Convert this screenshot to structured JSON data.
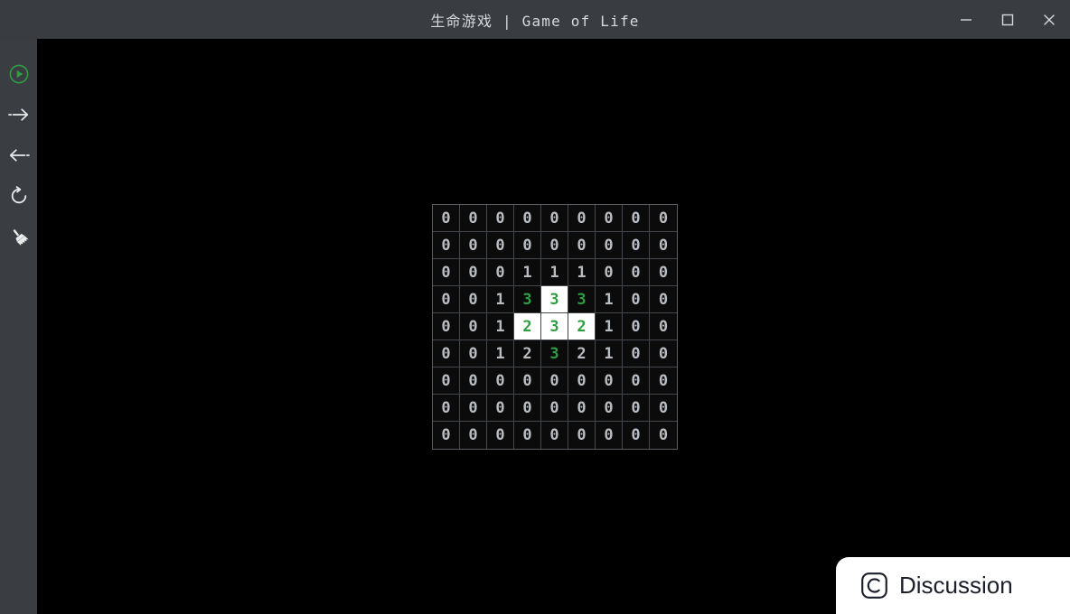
{
  "window": {
    "title": "生命游戏 | Game of Life",
    "controls": {
      "minimize": "minimize-button",
      "maximize": "maximize-button",
      "close": "close-button"
    }
  },
  "sidebar": {
    "items": [
      {
        "name": "play-button",
        "icon": "play-circle-icon",
        "color": "#2f9e41",
        "tooltip": "Play"
      },
      {
        "name": "step-forward-button",
        "icon": "arrow-right-icon",
        "color": "#e8eaec",
        "tooltip": "Step Forward"
      },
      {
        "name": "step-back-button",
        "icon": "arrow-left-icon",
        "color": "#e8eaec",
        "tooltip": "Step Back"
      },
      {
        "name": "reset-button",
        "icon": "refresh-icon",
        "color": "#e8eaec",
        "tooltip": "Reset"
      },
      {
        "name": "clear-button",
        "icon": "broom-icon",
        "color": "#e8eaec",
        "tooltip": "Clear"
      }
    ]
  },
  "discussion": {
    "label": "Discussion",
    "icon": "c-rounded-square-icon"
  },
  "colors": {
    "titlebar_bg": "#393c41",
    "sidebar_bg": "#3a3d42",
    "canvas_bg": "#000000",
    "cell_bg": "#0b0b0b",
    "cell_border": "#44474c",
    "grid_border": "#5a5d62",
    "text_dim": "#b9bcc0",
    "accent_green": "#2f9e41",
    "alive_bg": "#ffffff"
  },
  "grid": {
    "rows": 9,
    "cols": 9,
    "cell_size": 30,
    "cells": [
      [
        {
          "v": "0",
          "alive": false,
          "green": false
        },
        {
          "v": "0",
          "alive": false,
          "green": false
        },
        {
          "v": "0",
          "alive": false,
          "green": false
        },
        {
          "v": "0",
          "alive": false,
          "green": false
        },
        {
          "v": "0",
          "alive": false,
          "green": false
        },
        {
          "v": "0",
          "alive": false,
          "green": false
        },
        {
          "v": "0",
          "alive": false,
          "green": false
        },
        {
          "v": "0",
          "alive": false,
          "green": false
        },
        {
          "v": "0",
          "alive": false,
          "green": false
        }
      ],
      [
        {
          "v": "0",
          "alive": false,
          "green": false
        },
        {
          "v": "0",
          "alive": false,
          "green": false
        },
        {
          "v": "0",
          "alive": false,
          "green": false
        },
        {
          "v": "0",
          "alive": false,
          "green": false
        },
        {
          "v": "0",
          "alive": false,
          "green": false
        },
        {
          "v": "0",
          "alive": false,
          "green": false
        },
        {
          "v": "0",
          "alive": false,
          "green": false
        },
        {
          "v": "0",
          "alive": false,
          "green": false
        },
        {
          "v": "0",
          "alive": false,
          "green": false
        }
      ],
      [
        {
          "v": "0",
          "alive": false,
          "green": false
        },
        {
          "v": "0",
          "alive": false,
          "green": false
        },
        {
          "v": "0",
          "alive": false,
          "green": false
        },
        {
          "v": "1",
          "alive": false,
          "green": false
        },
        {
          "v": "1",
          "alive": false,
          "green": false
        },
        {
          "v": "1",
          "alive": false,
          "green": false
        },
        {
          "v": "0",
          "alive": false,
          "green": false
        },
        {
          "v": "0",
          "alive": false,
          "green": false
        },
        {
          "v": "0",
          "alive": false,
          "green": false
        }
      ],
      [
        {
          "v": "0",
          "alive": false,
          "green": false
        },
        {
          "v": "0",
          "alive": false,
          "green": false
        },
        {
          "v": "1",
          "alive": false,
          "green": false
        },
        {
          "v": "3",
          "alive": false,
          "green": true
        },
        {
          "v": "3",
          "alive": true,
          "green": true
        },
        {
          "v": "3",
          "alive": false,
          "green": true
        },
        {
          "v": "1",
          "alive": false,
          "green": false
        },
        {
          "v": "0",
          "alive": false,
          "green": false
        },
        {
          "v": "0",
          "alive": false,
          "green": false
        }
      ],
      [
        {
          "v": "0",
          "alive": false,
          "green": false
        },
        {
          "v": "0",
          "alive": false,
          "green": false
        },
        {
          "v": "1",
          "alive": false,
          "green": false
        },
        {
          "v": "2",
          "alive": true,
          "green": true
        },
        {
          "v": "3",
          "alive": true,
          "green": true
        },
        {
          "v": "2",
          "alive": true,
          "green": true
        },
        {
          "v": "1",
          "alive": false,
          "green": false
        },
        {
          "v": "0",
          "alive": false,
          "green": false
        },
        {
          "v": "0",
          "alive": false,
          "green": false
        }
      ],
      [
        {
          "v": "0",
          "alive": false,
          "green": false
        },
        {
          "v": "0",
          "alive": false,
          "green": false
        },
        {
          "v": "1",
          "alive": false,
          "green": false
        },
        {
          "v": "2",
          "alive": false,
          "green": false
        },
        {
          "v": "3",
          "alive": false,
          "green": true
        },
        {
          "v": "2",
          "alive": false,
          "green": false
        },
        {
          "v": "1",
          "alive": false,
          "green": false
        },
        {
          "v": "0",
          "alive": false,
          "green": false
        },
        {
          "v": "0",
          "alive": false,
          "green": false
        }
      ],
      [
        {
          "v": "0",
          "alive": false,
          "green": false
        },
        {
          "v": "0",
          "alive": false,
          "green": false
        },
        {
          "v": "0",
          "alive": false,
          "green": false
        },
        {
          "v": "0",
          "alive": false,
          "green": false
        },
        {
          "v": "0",
          "alive": false,
          "green": false
        },
        {
          "v": "0",
          "alive": false,
          "green": false
        },
        {
          "v": "0",
          "alive": false,
          "green": false
        },
        {
          "v": "0",
          "alive": false,
          "green": false
        },
        {
          "v": "0",
          "alive": false,
          "green": false
        }
      ],
      [
        {
          "v": "0",
          "alive": false,
          "green": false
        },
        {
          "v": "0",
          "alive": false,
          "green": false
        },
        {
          "v": "0",
          "alive": false,
          "green": false
        },
        {
          "v": "0",
          "alive": false,
          "green": false
        },
        {
          "v": "0",
          "alive": false,
          "green": false
        },
        {
          "v": "0",
          "alive": false,
          "green": false
        },
        {
          "v": "0",
          "alive": false,
          "green": false
        },
        {
          "v": "0",
          "alive": false,
          "green": false
        },
        {
          "v": "0",
          "alive": false,
          "green": false
        }
      ],
      [
        {
          "v": "0",
          "alive": false,
          "green": false
        },
        {
          "v": "0",
          "alive": false,
          "green": false
        },
        {
          "v": "0",
          "alive": false,
          "green": false
        },
        {
          "v": "0",
          "alive": false,
          "green": false
        },
        {
          "v": "0",
          "alive": false,
          "green": false
        },
        {
          "v": "0",
          "alive": false,
          "green": false
        },
        {
          "v": "0",
          "alive": false,
          "green": false
        },
        {
          "v": "0",
          "alive": false,
          "green": false
        },
        {
          "v": "0",
          "alive": false,
          "green": false
        }
      ]
    ]
  }
}
